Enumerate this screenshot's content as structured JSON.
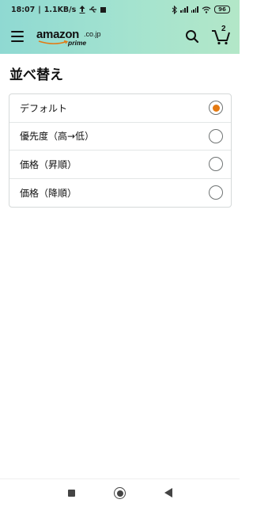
{
  "status_bar": {
    "time": "18:07",
    "network_speed": "1.1KB/s",
    "battery": "96",
    "icons": [
      "upload-arrow-icon",
      "usb-icon",
      "notification-icon",
      "bluetooth-icon",
      "signal-icon",
      "signal-icon",
      "wifi-icon",
      "battery-icon"
    ]
  },
  "header": {
    "logo": {
      "main": "amazon",
      "domain": ".co.jp",
      "sub": "prime"
    },
    "cart_count": "2",
    "colors": {
      "gradient_start": "#8fd9d2",
      "gradient_end": "#b3e7c8"
    }
  },
  "page": {
    "title": "並べ替え"
  },
  "sort_options": [
    {
      "label": "デフォルト",
      "selected": true
    },
    {
      "label": "優先度（高→低）",
      "selected": false
    },
    {
      "label": "価格（昇順）",
      "selected": false
    },
    {
      "label": "価格（降順）",
      "selected": false
    }
  ],
  "accent_color": "#e47911",
  "nav_bar": {
    "icons": [
      "recent-apps-icon",
      "home-icon",
      "back-icon"
    ]
  }
}
